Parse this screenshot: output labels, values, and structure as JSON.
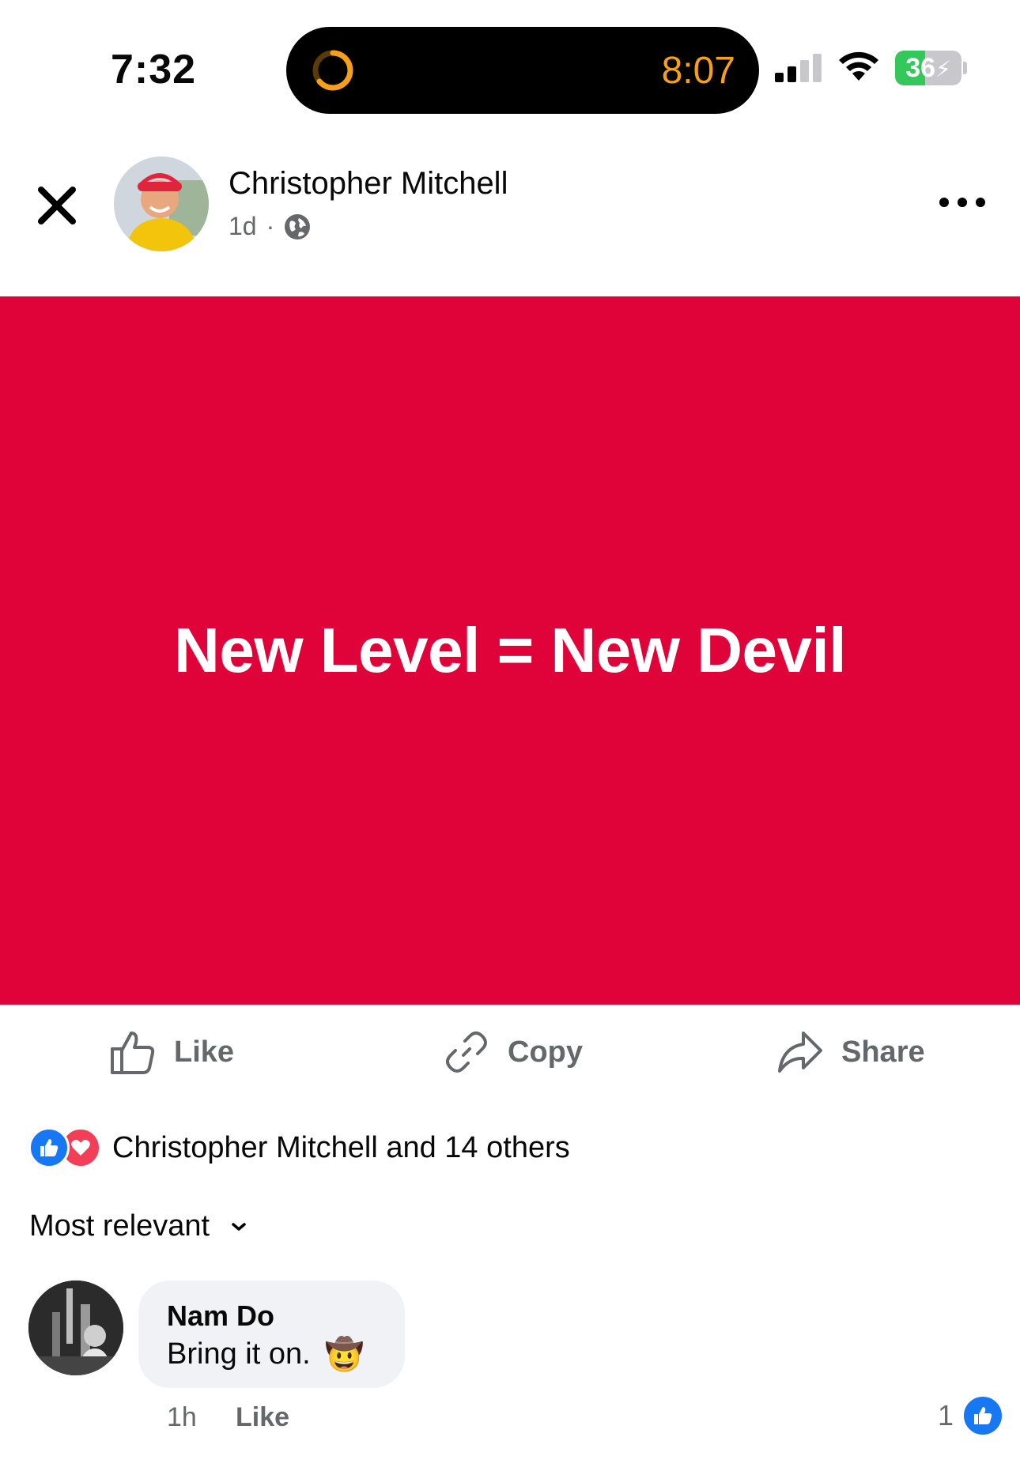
{
  "status_bar": {
    "time": "7:32",
    "live_activity_timer": "8:07",
    "battery_percent": "36",
    "signal_bars_active": 2
  },
  "post": {
    "author": "Christopher Mitchell",
    "age": "1d",
    "separator": "·",
    "audience_icon": "globe-icon",
    "text": "New Level = New Devil",
    "background_color": "#e0033a"
  },
  "actions": {
    "like": "Like",
    "copy": "Copy",
    "share": "Share"
  },
  "reactions": {
    "summary": "Christopher Mitchell and 14 others",
    "types": [
      "like",
      "love"
    ]
  },
  "comments": {
    "sort_label": "Most relevant",
    "items": [
      {
        "author": "Nam Do",
        "text": "Bring it on.",
        "emoji": "🤠",
        "time": "1h",
        "like_label": "Like",
        "like_count": "1"
      }
    ]
  },
  "colors": {
    "accent": "#1877f2",
    "love": "#f33e58",
    "timer": "#f6a01a"
  }
}
